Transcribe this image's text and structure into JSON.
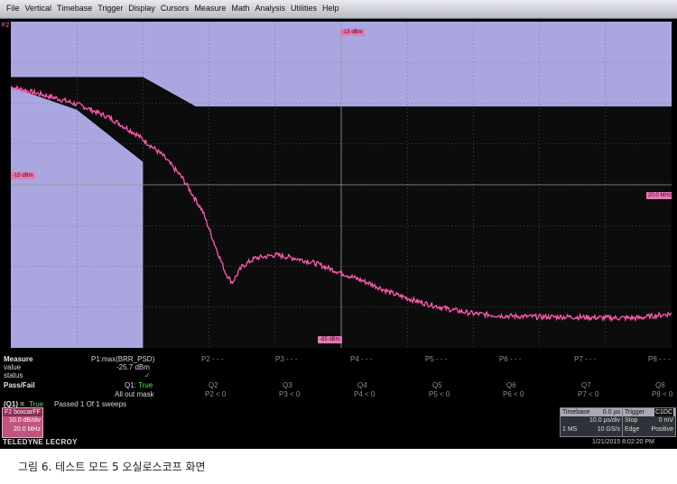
{
  "menu": [
    "File",
    "Vertical",
    "Timebase",
    "Trigger",
    "Display",
    "Cursors",
    "Measure",
    "Math",
    "Analysis",
    "Utilities",
    "Help"
  ],
  "grid_labels": {
    "f2_tag": "F2",
    "top_ref": "-15 dBm",
    "left_ref": "-15 dBm",
    "right_ref": "20.0 MHz",
    "bottom_ref": "-85 dBm"
  },
  "colors": {
    "trace": "#ff5ab0",
    "mask": "#a9a6e0",
    "marker": "#e879b2",
    "pass": "#55e655"
  },
  "trace_data": {
    "type": "line",
    "y_range_dB": [
      -105,
      -5
    ],
    "x_range_fraction": [
      0,
      1
    ],
    "points": [
      [
        0,
        -25
      ],
      [
        0.03,
        -26.5
      ],
      [
        0.07,
        -28.5
      ],
      [
        0.11,
        -31
      ],
      [
        0.15,
        -34.5
      ],
      [
        0.19,
        -39.5
      ],
      [
        0.23,
        -46
      ],
      [
        0.26,
        -53
      ],
      [
        0.29,
        -63
      ],
      [
        0.31,
        -74
      ],
      [
        0.325,
        -82
      ],
      [
        0.335,
        -85
      ],
      [
        0.35,
        -80
      ],
      [
        0.37,
        -77.5
      ],
      [
        0.4,
        -76.5
      ],
      [
        0.43,
        -77.5
      ],
      [
        0.46,
        -79
      ],
      [
        0.5,
        -82
      ],
      [
        0.54,
        -85
      ],
      [
        0.58,
        -88.5
      ],
      [
        0.62,
        -91
      ],
      [
        0.66,
        -93
      ],
      [
        0.7,
        -94.5
      ],
      [
        0.75,
        -95.2
      ],
      [
        0.8,
        -95.5
      ],
      [
        0.85,
        -95.5
      ],
      [
        0.9,
        -95.8
      ],
      [
        0.95,
        -95.8
      ],
      [
        1.0,
        -94.5
      ]
    ]
  },
  "mask_data": {
    "upper": [
      [
        0,
        -22
      ],
      [
        0.2,
        -22
      ],
      [
        0.28,
        -31
      ],
      [
        0.282,
        -31
      ],
      [
        1.0,
        -31
      ]
    ],
    "lower": [
      [
        0,
        -25
      ],
      [
        0.1,
        -32
      ],
      [
        0.2,
        -48
      ],
      [
        0.2,
        -105
      ]
    ]
  },
  "measure": {
    "label": "Measure",
    "value_label": "value",
    "status_label": "status",
    "p1_name": "P1:max(BRR_PSD)",
    "p1_value": "-25.7 dBm",
    "p1_status": "✓",
    "params": [
      {
        "name": "P2",
        "value": "- - -"
      },
      {
        "name": "P3",
        "value": "- - -"
      },
      {
        "name": "P4",
        "value": "- - -"
      },
      {
        "name": "P5",
        "value": "- - -"
      },
      {
        "name": "P6",
        "value": "- - -"
      },
      {
        "name": "P7",
        "value": "- - -"
      },
      {
        "name": "P8",
        "value": "- - -"
      }
    ]
  },
  "passfail": {
    "label": "Pass/Fail",
    "q1_name": "Q1:",
    "q1_value": "True",
    "q1_desc": "All out mask",
    "queries": [
      {
        "name": "Q2",
        "cond": "P2 < 0"
      },
      {
        "name": "Q3",
        "cond": "P3 < 0"
      },
      {
        "name": "Q4",
        "cond": "P4 < 0"
      },
      {
        "name": "Q5",
        "cond": "P5 < 0"
      },
      {
        "name": "Q6",
        "cond": "P6 < 0"
      },
      {
        "name": "Q7",
        "cond": "P7 < 0"
      },
      {
        "name": "Q8",
        "cond": "P8 < 0"
      }
    ],
    "summary_left": "(Q1) =",
    "summary_value": "True",
    "summary_passed": "Passed  1  Of  1  sweeps"
  },
  "f2": {
    "title": "F2  boxcarFF",
    "scale": "10.0 dB/div",
    "offset": "20.0 MHz"
  },
  "brand": "TELEDYNE LECROY",
  "timebase": {
    "title": "Timebase",
    "delay": "0.0 µs",
    "div": "10.0 µs/div",
    "points": "1 MS",
    "rate": "10 GS/s"
  },
  "trigger": {
    "title": "Trigger",
    "badge": "C1DC",
    "mode": "Stop",
    "level": "0 mV",
    "type": "Edge",
    "slope": "Positive"
  },
  "datetime": "1/21/2015 8:02:20 PM",
  "caption": "그림 6. 테스트 모드 5 오실로스코프 화면"
}
